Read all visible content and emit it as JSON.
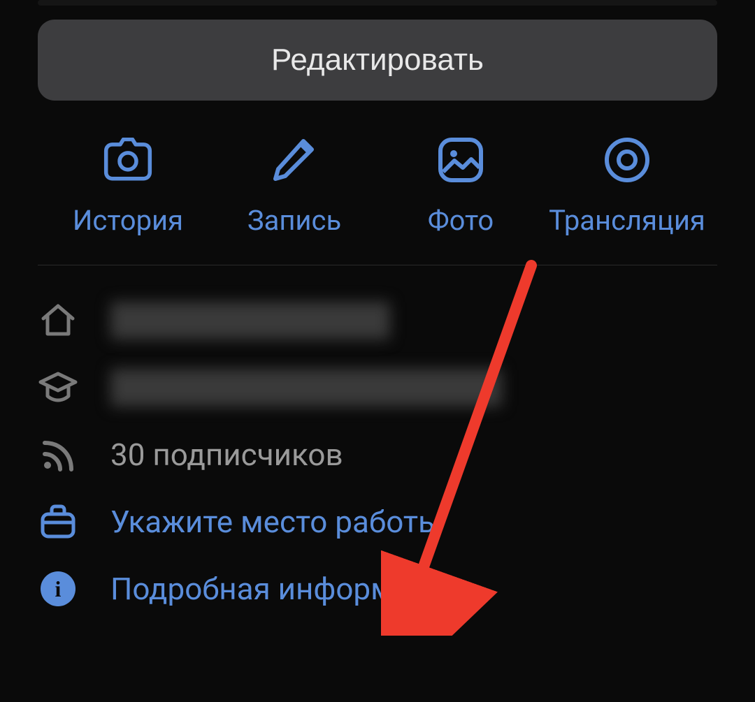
{
  "buttons": {
    "edit": "Редактировать"
  },
  "actions": {
    "story": "История",
    "post": "Запись",
    "photo": "Фото",
    "live": "Трансляция"
  },
  "info": {
    "followers": "30 подписчиков",
    "workplace_prompt": "Укажите место работы",
    "details": "Подробная информация"
  },
  "colors": {
    "accent": "#5a8ddb",
    "muted": "#9a9a9a",
    "background": "#0a0a0a",
    "button_bg": "#3d3d3f",
    "annotation_arrow": "#ee3a2c"
  }
}
